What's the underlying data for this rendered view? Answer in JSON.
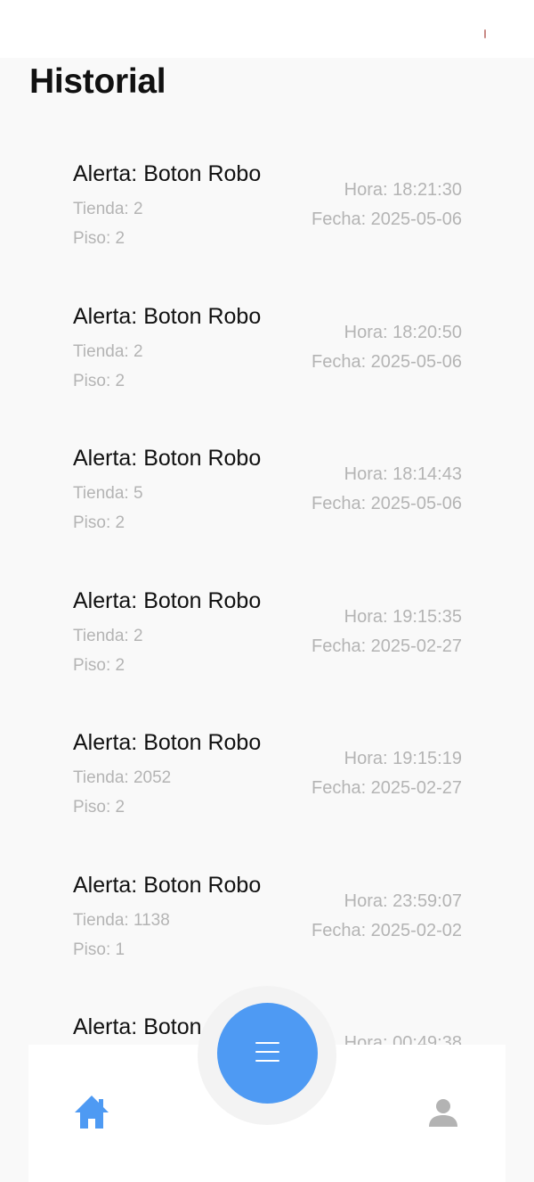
{
  "page": {
    "title": "Historial"
  },
  "alerts": [
    {
      "title": "Alerta: Boton Robo",
      "store": "Tienda: 2",
      "floor": "Piso: 2",
      "time": "Hora: 18:21:30",
      "date": "Fecha: 2025-05-06"
    },
    {
      "title": "Alerta: Boton Robo",
      "store": "Tienda: 2",
      "floor": "Piso: 2",
      "time": "Hora: 18:20:50",
      "date": "Fecha: 2025-05-06"
    },
    {
      "title": "Alerta: Boton Robo",
      "store": "Tienda: 5",
      "floor": "Piso: 2",
      "time": "Hora: 18:14:43",
      "date": "Fecha: 2025-05-06"
    },
    {
      "title": "Alerta: Boton Robo",
      "store": "Tienda: 2",
      "floor": "Piso: 2",
      "time": "Hora: 19:15:35",
      "date": "Fecha: 2025-02-27"
    },
    {
      "title": "Alerta: Boton Robo",
      "store": "Tienda: 2052",
      "floor": "Piso: 2",
      "time": "Hora: 19:15:19",
      "date": "Fecha: 2025-02-27"
    },
    {
      "title": "Alerta: Boton Robo",
      "store": "Tienda: 1138",
      "floor": "Piso: 1",
      "time": "Hora: 23:59:07",
      "date": "Fecha: 2025-02-02"
    },
    {
      "title": "Alerta: Boton Robo",
      "store": "",
      "floor": "",
      "time": "Hora: 00:49:38",
      "date": ""
    }
  ],
  "nav": {
    "home_icon": "home-icon",
    "menu_icon": "menu-icon",
    "profile_icon": "user-icon",
    "active_color": "#4e9af3",
    "inactive_color": "#b3b3b3"
  }
}
